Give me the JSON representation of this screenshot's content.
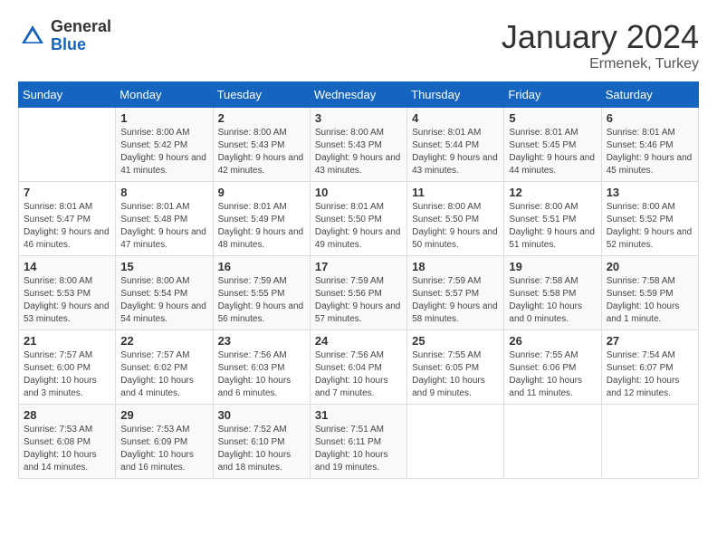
{
  "logo": {
    "general": "General",
    "blue": "Blue"
  },
  "title": "January 2024",
  "subtitle": "Ermenek, Turkey",
  "weekdays": [
    "Sunday",
    "Monday",
    "Tuesday",
    "Wednesday",
    "Thursday",
    "Friday",
    "Saturday"
  ],
  "weeks": [
    [
      {
        "day": "",
        "sunrise": "",
        "sunset": "",
        "daylight": ""
      },
      {
        "day": "1",
        "sunrise": "Sunrise: 8:00 AM",
        "sunset": "Sunset: 5:42 PM",
        "daylight": "Daylight: 9 hours and 41 minutes."
      },
      {
        "day": "2",
        "sunrise": "Sunrise: 8:00 AM",
        "sunset": "Sunset: 5:43 PM",
        "daylight": "Daylight: 9 hours and 42 minutes."
      },
      {
        "day": "3",
        "sunrise": "Sunrise: 8:00 AM",
        "sunset": "Sunset: 5:43 PM",
        "daylight": "Daylight: 9 hours and 43 minutes."
      },
      {
        "day": "4",
        "sunrise": "Sunrise: 8:01 AM",
        "sunset": "Sunset: 5:44 PM",
        "daylight": "Daylight: 9 hours and 43 minutes."
      },
      {
        "day": "5",
        "sunrise": "Sunrise: 8:01 AM",
        "sunset": "Sunset: 5:45 PM",
        "daylight": "Daylight: 9 hours and 44 minutes."
      },
      {
        "day": "6",
        "sunrise": "Sunrise: 8:01 AM",
        "sunset": "Sunset: 5:46 PM",
        "daylight": "Daylight: 9 hours and 45 minutes."
      }
    ],
    [
      {
        "day": "7",
        "sunrise": "Sunrise: 8:01 AM",
        "sunset": "Sunset: 5:47 PM",
        "daylight": "Daylight: 9 hours and 46 minutes."
      },
      {
        "day": "8",
        "sunrise": "Sunrise: 8:01 AM",
        "sunset": "Sunset: 5:48 PM",
        "daylight": "Daylight: 9 hours and 47 minutes."
      },
      {
        "day": "9",
        "sunrise": "Sunrise: 8:01 AM",
        "sunset": "Sunset: 5:49 PM",
        "daylight": "Daylight: 9 hours and 48 minutes."
      },
      {
        "day": "10",
        "sunrise": "Sunrise: 8:01 AM",
        "sunset": "Sunset: 5:50 PM",
        "daylight": "Daylight: 9 hours and 49 minutes."
      },
      {
        "day": "11",
        "sunrise": "Sunrise: 8:00 AM",
        "sunset": "Sunset: 5:50 PM",
        "daylight": "Daylight: 9 hours and 50 minutes."
      },
      {
        "day": "12",
        "sunrise": "Sunrise: 8:00 AM",
        "sunset": "Sunset: 5:51 PM",
        "daylight": "Daylight: 9 hours and 51 minutes."
      },
      {
        "day": "13",
        "sunrise": "Sunrise: 8:00 AM",
        "sunset": "Sunset: 5:52 PM",
        "daylight": "Daylight: 9 hours and 52 minutes."
      }
    ],
    [
      {
        "day": "14",
        "sunrise": "Sunrise: 8:00 AM",
        "sunset": "Sunset: 5:53 PM",
        "daylight": "Daylight: 9 hours and 53 minutes."
      },
      {
        "day": "15",
        "sunrise": "Sunrise: 8:00 AM",
        "sunset": "Sunset: 5:54 PM",
        "daylight": "Daylight: 9 hours and 54 minutes."
      },
      {
        "day": "16",
        "sunrise": "Sunrise: 7:59 AM",
        "sunset": "Sunset: 5:55 PM",
        "daylight": "Daylight: 9 hours and 56 minutes."
      },
      {
        "day": "17",
        "sunrise": "Sunrise: 7:59 AM",
        "sunset": "Sunset: 5:56 PM",
        "daylight": "Daylight: 9 hours and 57 minutes."
      },
      {
        "day": "18",
        "sunrise": "Sunrise: 7:59 AM",
        "sunset": "Sunset: 5:57 PM",
        "daylight": "Daylight: 9 hours and 58 minutes."
      },
      {
        "day": "19",
        "sunrise": "Sunrise: 7:58 AM",
        "sunset": "Sunset: 5:58 PM",
        "daylight": "Daylight: 10 hours and 0 minutes."
      },
      {
        "day": "20",
        "sunrise": "Sunrise: 7:58 AM",
        "sunset": "Sunset: 5:59 PM",
        "daylight": "Daylight: 10 hours and 1 minute."
      }
    ],
    [
      {
        "day": "21",
        "sunrise": "Sunrise: 7:57 AM",
        "sunset": "Sunset: 6:00 PM",
        "daylight": "Daylight: 10 hours and 3 minutes."
      },
      {
        "day": "22",
        "sunrise": "Sunrise: 7:57 AM",
        "sunset": "Sunset: 6:02 PM",
        "daylight": "Daylight: 10 hours and 4 minutes."
      },
      {
        "day": "23",
        "sunrise": "Sunrise: 7:56 AM",
        "sunset": "Sunset: 6:03 PM",
        "daylight": "Daylight: 10 hours and 6 minutes."
      },
      {
        "day": "24",
        "sunrise": "Sunrise: 7:56 AM",
        "sunset": "Sunset: 6:04 PM",
        "daylight": "Daylight: 10 hours and 7 minutes."
      },
      {
        "day": "25",
        "sunrise": "Sunrise: 7:55 AM",
        "sunset": "Sunset: 6:05 PM",
        "daylight": "Daylight: 10 hours and 9 minutes."
      },
      {
        "day": "26",
        "sunrise": "Sunrise: 7:55 AM",
        "sunset": "Sunset: 6:06 PM",
        "daylight": "Daylight: 10 hours and 11 minutes."
      },
      {
        "day": "27",
        "sunrise": "Sunrise: 7:54 AM",
        "sunset": "Sunset: 6:07 PM",
        "daylight": "Daylight: 10 hours and 12 minutes."
      }
    ],
    [
      {
        "day": "28",
        "sunrise": "Sunrise: 7:53 AM",
        "sunset": "Sunset: 6:08 PM",
        "daylight": "Daylight: 10 hours and 14 minutes."
      },
      {
        "day": "29",
        "sunrise": "Sunrise: 7:53 AM",
        "sunset": "Sunset: 6:09 PM",
        "daylight": "Daylight: 10 hours and 16 minutes."
      },
      {
        "day": "30",
        "sunrise": "Sunrise: 7:52 AM",
        "sunset": "Sunset: 6:10 PM",
        "daylight": "Daylight: 10 hours and 18 minutes."
      },
      {
        "day": "31",
        "sunrise": "Sunrise: 7:51 AM",
        "sunset": "Sunset: 6:11 PM",
        "daylight": "Daylight: 10 hours and 19 minutes."
      },
      {
        "day": "",
        "sunrise": "",
        "sunset": "",
        "daylight": ""
      },
      {
        "day": "",
        "sunrise": "",
        "sunset": "",
        "daylight": ""
      },
      {
        "day": "",
        "sunrise": "",
        "sunset": "",
        "daylight": ""
      }
    ]
  ]
}
